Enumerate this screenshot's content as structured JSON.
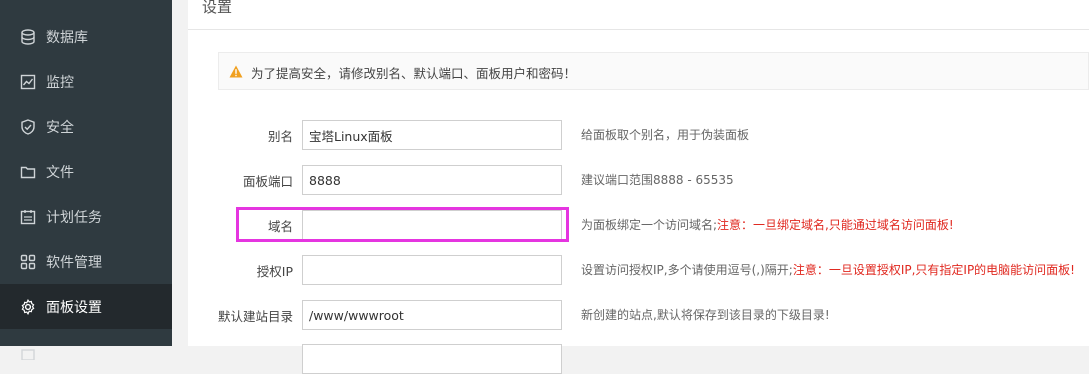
{
  "sidebar": {
    "items": [
      {
        "label": "数据库",
        "icon": "database-icon"
      },
      {
        "label": "监控",
        "icon": "monitor-icon"
      },
      {
        "label": "安全",
        "icon": "shield-icon"
      },
      {
        "label": "文件",
        "icon": "folder-icon"
      },
      {
        "label": "计划任务",
        "icon": "calendar-icon"
      },
      {
        "label": "软件管理",
        "icon": "grid-icon"
      },
      {
        "label": "面板设置",
        "icon": "gear-icon",
        "active": true
      }
    ]
  },
  "main": {
    "title": "设置",
    "notice": "为了提高安全，请修改别名、默认端口、面板用户和密码！",
    "fields": [
      {
        "label": "别名",
        "value": "宝塔Linux面板",
        "help": "给面板取个别名，用于伪装面板",
        "help_warn": ""
      },
      {
        "label": "面板端口",
        "value": "8888",
        "help": "建议端口范围8888 - 65535",
        "help_warn": ""
      },
      {
        "label": "域名",
        "value": "",
        "help": "为面板绑定一个访问域名;",
        "help_warn": "注意：一旦绑定域名,只能通过域名访问面板!"
      },
      {
        "label": "授权IP",
        "value": "",
        "help": "设置访问授权IP,多个请使用逗号(,)隔开;",
        "help_warn": "注意：一旦设置授权IP,只有指定IP的电脑能访问面板!"
      },
      {
        "label": "默认建站目录",
        "value": "/www/wwwroot",
        "help": "新创建的站点,默认将保存到该目录的下级目录!",
        "help_warn": ""
      }
    ]
  },
  "colors": {
    "sidebar_bg": "#2f3a40",
    "sidebar_active_bg": "#23292d",
    "highlight_border": "#e535e0",
    "warning_text": "#e0281f",
    "warning_icon": "#f0a020"
  }
}
